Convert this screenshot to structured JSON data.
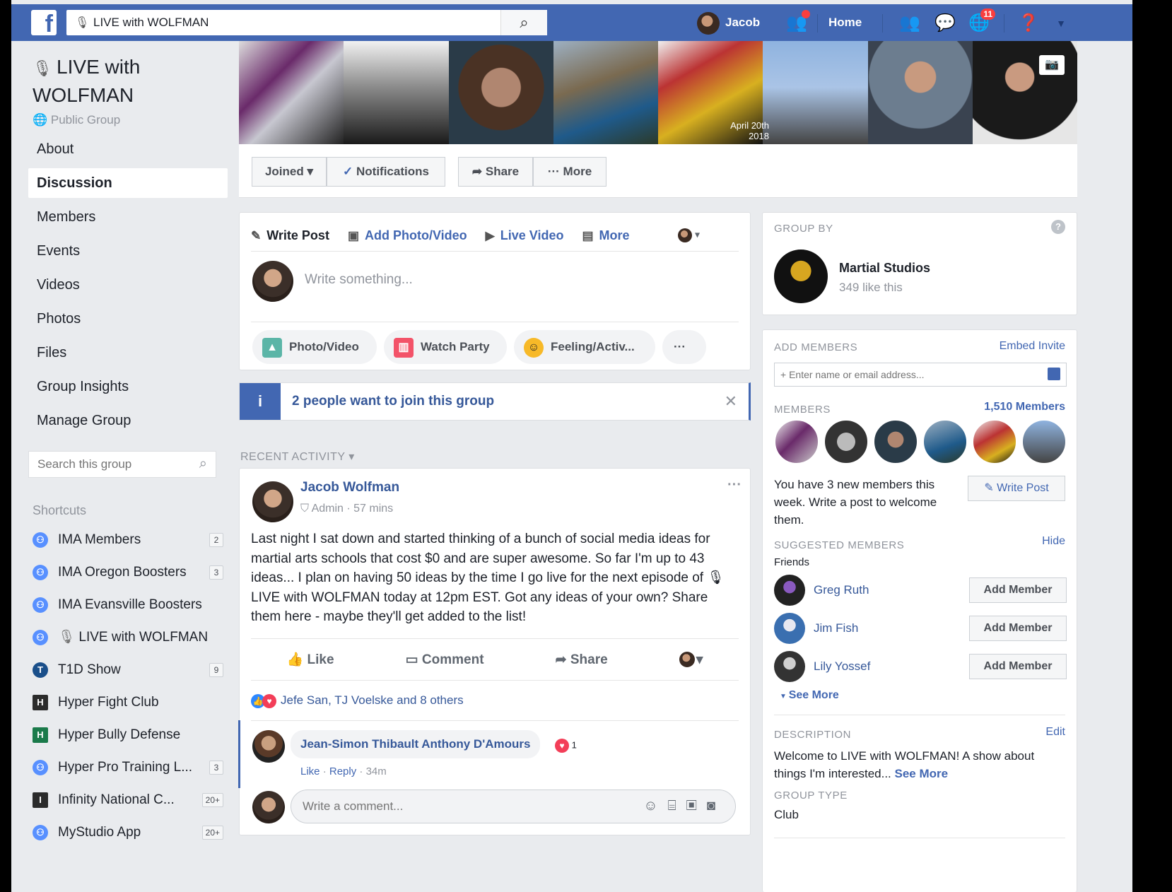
{
  "topbar": {
    "logo": "f",
    "search_value": "LIVE with WOLFMAN",
    "search_icon": "search-icon",
    "profile_name": "Jacob",
    "home_label": "Home",
    "notifications_count": "11"
  },
  "group": {
    "title": "LIVE with WOLFMAN",
    "privacy": "Public Group"
  },
  "menu": [
    "About",
    "Discussion",
    "Members",
    "Events",
    "Videos",
    "Photos",
    "Files",
    "Group Insights",
    "Manage Group"
  ],
  "menu_active": "Discussion",
  "group_search_placeholder": "Search this group",
  "shortcuts": {
    "heading": "Shortcuts",
    "items": [
      {
        "label": "IMA Members",
        "count": "2"
      },
      {
        "label": "IMA Oregon Boosters",
        "count": "3"
      },
      {
        "label": "IMA Evansville Boosters",
        "count": ""
      },
      {
        "label": "LIVE with WOLFMAN",
        "count": ""
      },
      {
        "label": "T1D Show",
        "count": "9"
      },
      {
        "label": "Hyper Fight Club",
        "count": ""
      },
      {
        "label": "Hyper Bully Defense",
        "count": ""
      },
      {
        "label": "Hyper Pro Training L...",
        "count": "3"
      },
      {
        "label": "Infinity National C...",
        "count": "20+"
      },
      {
        "label": "MyStudio App",
        "count": "20+"
      }
    ]
  },
  "cover": {
    "date_text": "April 20th 2018"
  },
  "actions": {
    "joined": "Joined ▾",
    "notifications": "Notifications",
    "share": "Share",
    "more": "··· More"
  },
  "composer": {
    "tabs": [
      "Write Post",
      "Add Photo/Video",
      "Live Video",
      "More"
    ],
    "placeholder": "Write something...",
    "pills": [
      "Photo/Video",
      "Watch Party",
      "Feeling/Activ...",
      "···"
    ]
  },
  "join_banner": {
    "text": "2 people want to join this group"
  },
  "recent_activity": "RECENT ACTIVITY ▾",
  "post": {
    "author": "Jacob Wolfman",
    "meta": "Admin · 57 mins",
    "text": "Last night I sat down and started thinking of a bunch of social media ideas for martial arts schools that cost $0 and are super awesome. So far I'm up to 43 ideas... I plan on having 50 ideas by the time I go live for the next episode of 🎙 LIVE with WOLFMAN today at 12pm EST. Got any ideas of your own? Share them here - maybe they'll get added to the list!",
    "actions": [
      "Like",
      "Comment",
      "Share"
    ],
    "reactions": "Jefe San, TJ Voelske and 8 others",
    "comment_author": "Jean-Simon Thibault Anthony D'Amours",
    "comment_reaction_count": "1",
    "comment_meta_like": "Like",
    "comment_meta_reply": "Reply",
    "comment_meta_time": "34m",
    "comment_placeholder": "Write a comment..."
  },
  "group_by": {
    "heading": "GROUP BY",
    "name": "Martial Studios",
    "likes": "349 like this"
  },
  "add_members": {
    "heading": "ADD MEMBERS",
    "embed": "Embed Invite",
    "placeholder": "+ Enter name or email address..."
  },
  "members": {
    "heading": "MEMBERS",
    "count": "1,510 Members",
    "new_text": "You have 3 new members this week. Write a post to welcome them.",
    "write_post": "Write Post"
  },
  "suggested": {
    "heading": "SUGGESTED MEMBERS",
    "hide": "Hide",
    "sub": "Friends",
    "people": [
      "Greg Ruth",
      "Jim Fish",
      "Lily Yossef"
    ],
    "add_label": "Add Member",
    "see_more": "See More"
  },
  "description": {
    "heading": "DESCRIPTION",
    "edit": "Edit",
    "text": "Welcome to LIVE with WOLFMAN! A show about things I'm interested...",
    "see_more": "See More",
    "type_heading": "GROUP TYPE",
    "type": "Club"
  },
  "colors": {
    "brand": "#4267b2",
    "link": "#365899",
    "page_bg": "#e9ebee"
  }
}
